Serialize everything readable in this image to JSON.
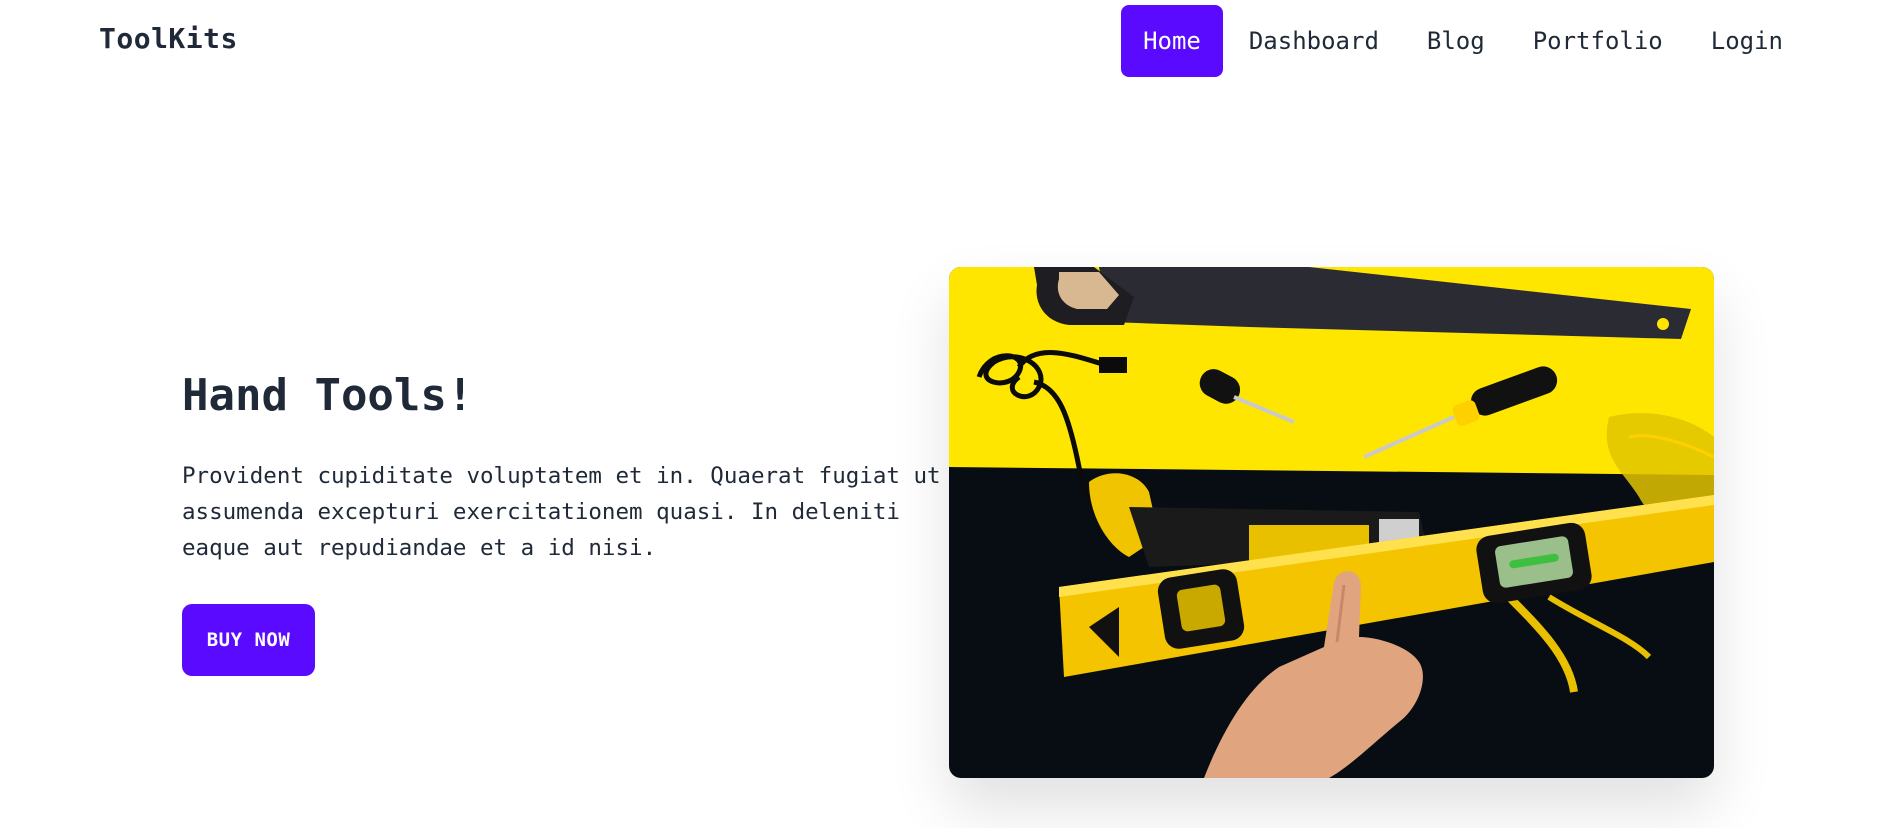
{
  "brand": {
    "name": "ToolKits"
  },
  "nav": {
    "items": [
      {
        "label": "Home",
        "active": true
      },
      {
        "label": "Dashboard",
        "active": false
      },
      {
        "label": "Blog",
        "active": false
      },
      {
        "label": "Portfolio",
        "active": false
      },
      {
        "label": "Login",
        "active": false
      }
    ]
  },
  "hero": {
    "title": "Hand Tools!",
    "text": "Provident cupiditate voluptatem et in. Quaerat fugiat ut assumenda excepturi exercitationem quasi. In deleniti eaque aut repudiandae et a id nisi.",
    "button_label": "BUY NOW"
  },
  "colors": {
    "accent": "#5a0bff",
    "text": "#1f2937",
    "image_yellow": "#ffe600",
    "image_black": "#070d12"
  }
}
